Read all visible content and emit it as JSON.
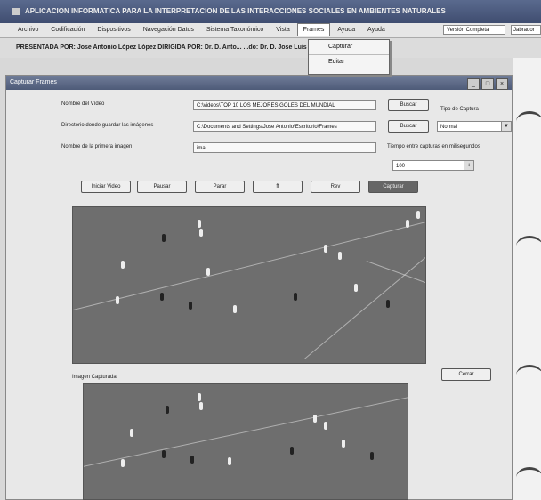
{
  "app": {
    "title": "APLICACION INFORMATICA PARA LA INTERPRETACION DE LAS INTERACCIONES SOCIALES EN AMBIENTES NATURALES"
  },
  "menu": {
    "items": [
      "Archivo",
      "Codificación",
      "Dispositivos",
      "Navegación Datos",
      "Sistema Taxonómico",
      "Vista",
      "Frames",
      "Ayuda",
      "Ayuda"
    ],
    "active": "Frames",
    "version": "Versión Completa",
    "user": "Jabrador"
  },
  "presented": "PRESENTADA POR: Jose Antonio López López    DIRIGIDA POR: Dr. D. Anto...    ...do: Dr. D. Jose Luis Pastrana Brincones",
  "frames_dropdown": [
    "Capturar",
    "Editar"
  ],
  "dialog": {
    "title": "Capturar Frames",
    "video_label": "Nombre del Vídeo",
    "video_value": "C:\\videos\\TOP 10 LOS MEJORES GOLES DEL MUNDIAL",
    "dir_label": "Directorio donde guardar las imágenes",
    "dir_value": "C:\\Documents and Settings\\Jose Antonio\\Escritorio\\Frames",
    "first_label": "Nombre de la primera imagen",
    "first_value": "ima",
    "browse1": "Buscar",
    "browse2": "Buscar",
    "capture_type_label": "Tipo de Captura",
    "capture_type_value": "Normal",
    "interval_label": "Tiempo entre capturas en milisegundos",
    "interval_value": "100",
    "buttons": {
      "start": "Iniciar Video",
      "pause": "Pausar",
      "stop": "Parar",
      "ff": "ff",
      "rev": "Rev",
      "capture": "Capturar"
    },
    "captured_label": "Imagen Capturada",
    "clear": "Cerrar"
  }
}
